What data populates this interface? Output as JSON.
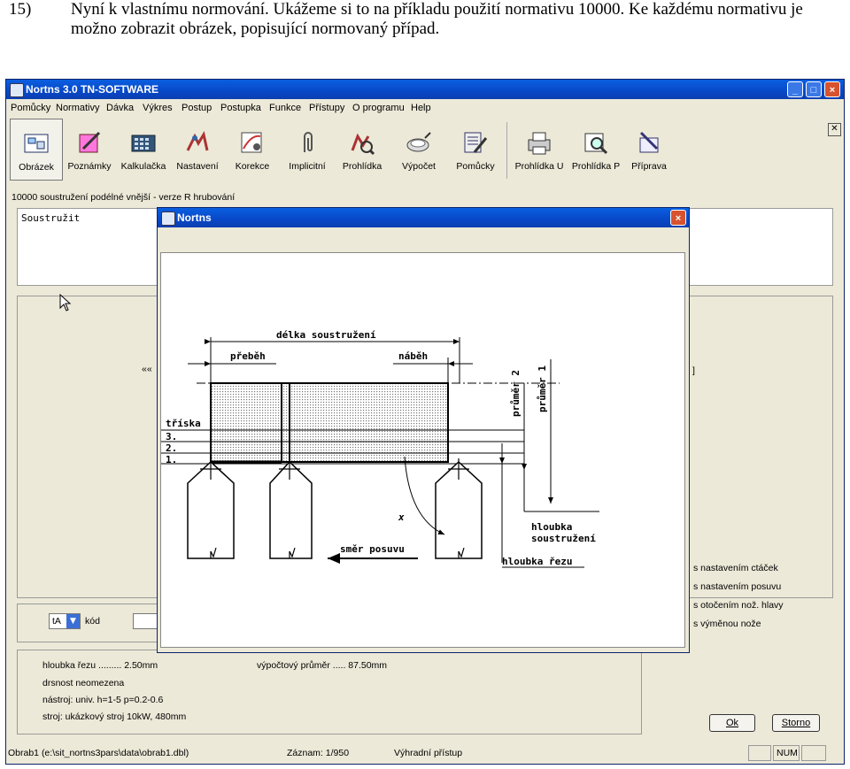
{
  "document": {
    "item_number": "15)",
    "line1": "Nyní k vlastnímu normování. Ukážeme si to na příkladu použití normativu 10000. Ke každému normativu je",
    "line2": "možno zobrazit obrázek, popisující normovaný případ."
  },
  "window": {
    "title": "Nortns 3.0 TN-SOFTWARE",
    "buttons": [
      "_",
      "□",
      "×"
    ]
  },
  "menu": [
    "Pomůcky",
    "Normativy",
    "Dávka",
    "Výkres",
    "Postup",
    "Postupka",
    "Funkce",
    "Přístupy",
    "O programu",
    "Help"
  ],
  "toolbar": [
    {
      "label": "Obrázek",
      "icon": "picture-icon"
    },
    {
      "label": "Poznámky",
      "icon": "notes-icon"
    },
    {
      "label": "Kalkulačka",
      "icon": "calculator-icon"
    },
    {
      "label": "Nastavení",
      "icon": "settings-icon"
    },
    {
      "label": "Korekce",
      "icon": "correction-icon"
    },
    {
      "label": "Implicitní",
      "icon": "paperclip-icon"
    },
    {
      "label": "Prohlídka",
      "icon": "inspect-icon"
    },
    {
      "label": "Výpočet",
      "icon": "calc-dish-icon"
    },
    {
      "label": "Pomůcky",
      "icon": "tools-icon"
    },
    {
      "label": "Prohlídka U",
      "icon": "printer-u-icon"
    },
    {
      "label": "Prohlídka P",
      "icon": "preview-p-icon"
    },
    {
      "label": "Příprava",
      "icon": "prepare-icon"
    }
  ],
  "normative_label": "10000 soustružení podélné vnější - verze R hrubování",
  "description_text": "Soustružit",
  "left_arrows": "««",
  "right_bracket": "]",
  "options": [
    "s nastavením ctáček",
    "s nastavením posuvu",
    "s otočením nož. hlavy",
    "s výměnou nože"
  ],
  "filter": {
    "select_value": "tA",
    "code_label": "kód",
    "code_value": ""
  },
  "info": {
    "line1": "hloubka řezu ......... 2.50mm",
    "line1b": "výpočtový průměr .....    87.50mm",
    "line2": "drsnost neomezena",
    "line3": "nástroj: univ. h=1-5 p=0.2-0.6",
    "line4": "stroj: ukázkový stroj 10kW, 480mm"
  },
  "buttons": {
    "ok": "Ok",
    "cancel": "Storno"
  },
  "statusbar": {
    "file": "Obrab1 (e:\\sit_nortns3pars\\data\\obrab1.dbl)",
    "record": "Záznam: 1/950",
    "access": "Výhradní přístup",
    "num": "NUM"
  },
  "dialog": {
    "title": "Nortns",
    "close": "×",
    "drawing": {
      "length_label": "délka soustružení",
      "overrun_label": "přeběh",
      "approach_label": "náběh",
      "chip_label": "tříska",
      "pass3": "3.",
      "pass2": "2.",
      "pass1": "1.",
      "diameter2_label": "průměr 2",
      "diameter1_label": "průměr 1",
      "turn_depth_label_1": "hloubka",
      "turn_depth_label_2": "soustružení",
      "cut_depth_label": "hloubka řezu",
      "feed_label": "směr posuvu",
      "angle_label": "x"
    }
  },
  "colors": {
    "titlebar": "#0848c8",
    "chrome": "#ece9d8"
  }
}
